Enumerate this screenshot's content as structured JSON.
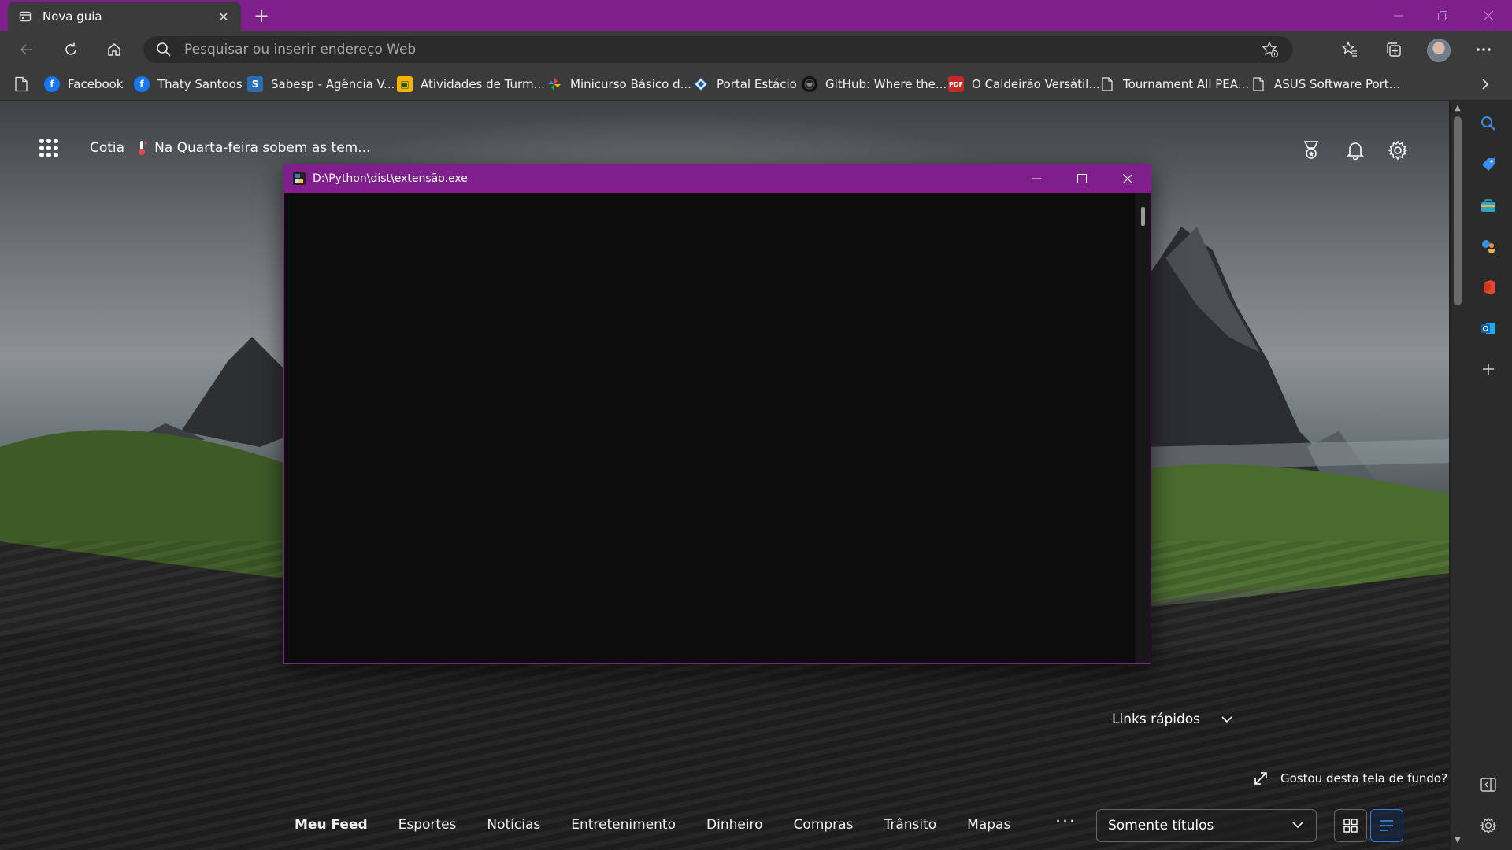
{
  "browser": {
    "tab": {
      "title": "Nova guia"
    },
    "address_bar": {
      "placeholder": "Pesquisar ou inserir endereço Web"
    },
    "favorites": [
      {
        "label": "Facebook",
        "icon": "facebook-icon"
      },
      {
        "label": "Thaty Santoos",
        "icon": "facebook-icon"
      },
      {
        "label": "Sabesp - Agência V...",
        "icon": "sabesp-icon"
      },
      {
        "label": "Atividades de Turm...",
        "icon": "classroom-icon"
      },
      {
        "label": "Minicurso Básico d...",
        "icon": "pinwheel-icon"
      },
      {
        "label": "Portal Estácio",
        "icon": "estacio-icon"
      },
      {
        "label": "GitHub: Where the...",
        "icon": "github-icon"
      },
      {
        "label": "O Caldeirão Versátil...",
        "icon": "pdf-icon"
      },
      {
        "label": "Tournament All PEA...",
        "icon": "document-icon"
      },
      {
        "label": "ASUS Software Port...",
        "icon": "document-icon"
      }
    ],
    "accent_color": "#7e1f8c"
  },
  "newtab": {
    "location": "Cotia",
    "headline": "Na Quarta-feira sobem as tem...",
    "quick_links": "Links rápidos",
    "wallpaper_prompt": "Gostou desta tela de fundo?",
    "feed_tabs": [
      "Meu Feed",
      "Esportes",
      "Notícias",
      "Entretenimento",
      "Dinheiro",
      "Compras",
      "Trânsito",
      "Mapas"
    ],
    "more": "···",
    "view_select": "Somente títulos"
  },
  "console": {
    "title": "D:\\Python\\dist\\extensão.exe",
    "background": "#0c0c0c"
  }
}
